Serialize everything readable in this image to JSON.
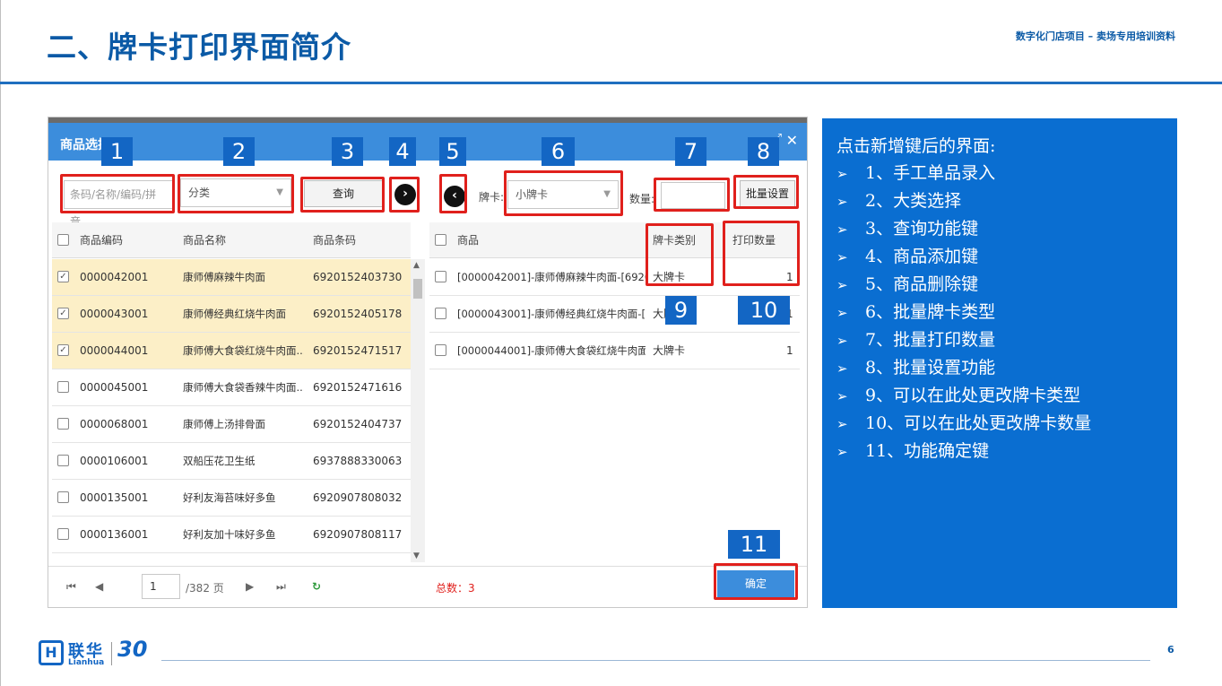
{
  "slide": {
    "title": "二、牌卡打印界面简介",
    "subtitle": "数字化门店项目 – 卖场专用培训资料",
    "page_number": "6"
  },
  "logo": {
    "cn": "联华",
    "en": "Lianhua",
    "mark": "H",
    "anniv": "30"
  },
  "dialog": {
    "title": "商品选择",
    "search": {
      "placeholder": "条码/名称/编码/拼音"
    },
    "category": {
      "value": "分类"
    },
    "query_label": "查询",
    "add_icon": "›",
    "remove_icon": "‹",
    "card_type_label": "牌卡:",
    "card_type_value": "小牌卡",
    "quantity_label": "数量:",
    "quantity_value": "",
    "batch_set_label": "批量设置",
    "left_table": {
      "headers": [
        "商品编码",
        "商品名称",
        "商品条码"
      ],
      "rows": [
        {
          "code": "0000042001",
          "name": "康师傅麻辣牛肉面",
          "barcode": "6920152403730",
          "checked": true
        },
        {
          "code": "0000043001",
          "name": "康师傅经典红烧牛肉面",
          "barcode": "6920152405178",
          "checked": true
        },
        {
          "code": "0000044001",
          "name": "康师傅大食袋红烧牛肉面...",
          "barcode": "6920152471517",
          "checked": true
        },
        {
          "code": "0000045001",
          "name": "康师傅大食袋香辣牛肉面...",
          "barcode": "6920152471616",
          "checked": false
        },
        {
          "code": "0000068001",
          "name": "康师傅上汤排骨面",
          "barcode": "6920152404737",
          "checked": false
        },
        {
          "code": "0000106001",
          "name": "双船压花卫生纸",
          "barcode": "6937888330063",
          "checked": false
        },
        {
          "code": "0000135001",
          "name": "好利友海苔味好多鱼",
          "barcode": "6920907808032",
          "checked": false
        },
        {
          "code": "0000136001",
          "name": "好利友加十味好多鱼",
          "barcode": "6920907808117",
          "checked": false
        }
      ]
    },
    "right_table": {
      "headers": [
        "商品",
        "牌卡类别",
        "打印数量"
      ],
      "rows": [
        {
          "product": "[0000042001]-康师傅麻辣牛肉面-[6920...",
          "card": "大牌卡",
          "qty": "1"
        },
        {
          "product": "[0000043001]-康师傅经典红烧牛肉面-[6...",
          "card": "大牌卡",
          "qty": "1"
        },
        {
          "product": "[0000044001]-康师傅大食袋红烧牛肉面(...",
          "card": "大牌卡",
          "qty": "1"
        }
      ]
    },
    "pager": {
      "page": "1",
      "total_pages": "/382 页",
      "total_count": "总数：3"
    },
    "confirm_label": "确定"
  },
  "callouts": [
    "1",
    "2",
    "3",
    "4",
    "5",
    "6",
    "7",
    "8",
    "9",
    "10",
    "11"
  ],
  "info": {
    "title": "点击新增键后的界面:",
    "items": [
      "1、手工单品录入",
      "2、大类选择",
      "3、查询功能键",
      "4、商品添加键",
      "5、商品删除键",
      "6、批量牌卡类型",
      "7、批量打印数量",
      "8、批量设置功能",
      "9、可以在此处更改牌卡类型",
      "10、可以在此处更改牌卡数量",
      "11、功能确定键"
    ]
  },
  "colors": {
    "brand": "#0b5aa6",
    "header": "#3c8ddc",
    "highlight": "#e0201c",
    "panel": "#0a6ed1",
    "selected_row": "#fcefc7"
  }
}
